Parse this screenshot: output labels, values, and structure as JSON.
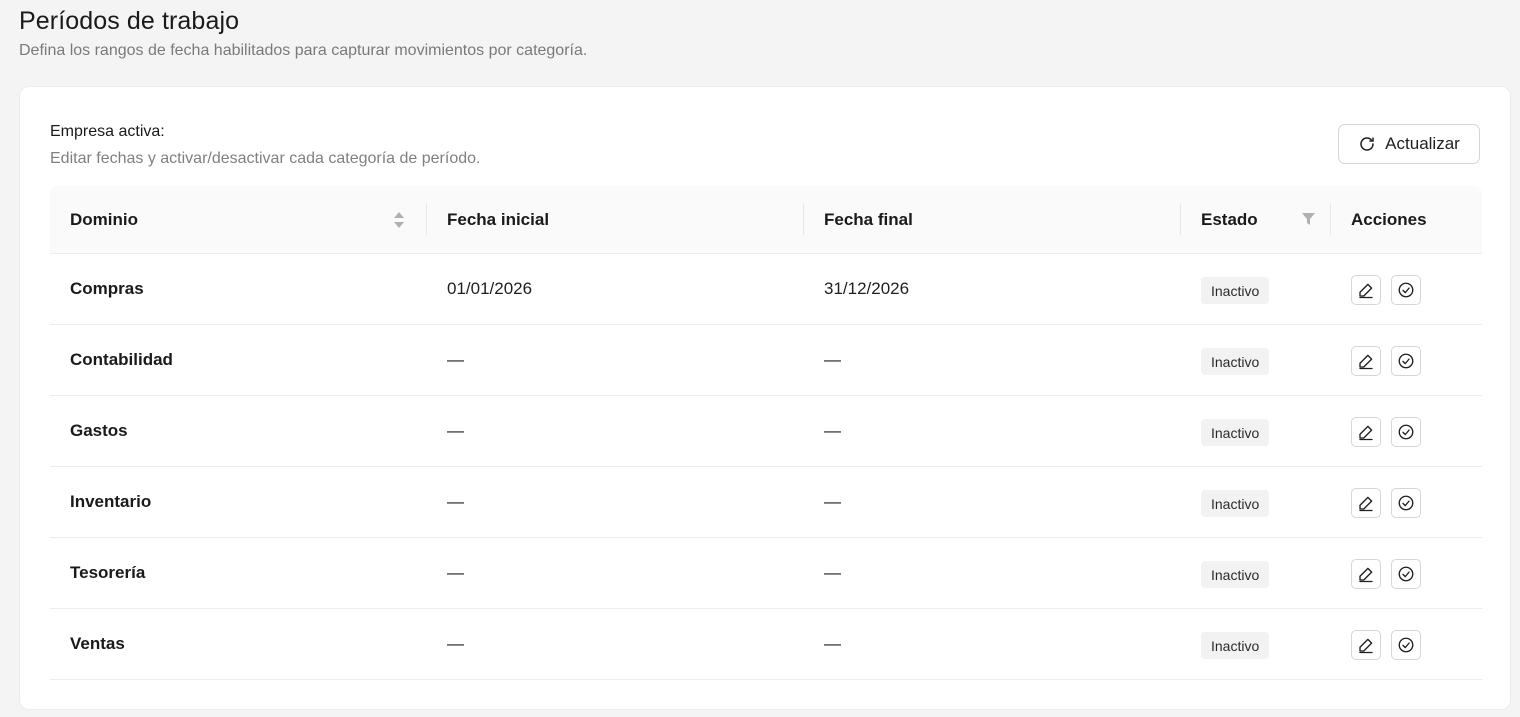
{
  "header": {
    "title": "Períodos de trabajo",
    "subtitle": "Defina los rangos de fecha habilitados para capturar movimientos por categoría."
  },
  "card": {
    "company_label": "Empresa activa:",
    "company_description": "Editar fechas y activar/desactivar cada categoría de período.",
    "refresh_label": "Actualizar"
  },
  "table": {
    "columns": {
      "domain": "Dominio",
      "start_date": "Fecha inicial",
      "end_date": "Fecha final",
      "status": "Estado",
      "actions": "Acciones"
    },
    "rows": [
      {
        "domain": "Compras",
        "start_date": "01/01/2026",
        "end_date": "31/12/2026",
        "status": "Inactivo"
      },
      {
        "domain": "Contabilidad",
        "start_date": "—",
        "end_date": "—",
        "status": "Inactivo"
      },
      {
        "domain": "Gastos",
        "start_date": "—",
        "end_date": "—",
        "status": "Inactivo"
      },
      {
        "domain": "Inventario",
        "start_date": "—",
        "end_date": "—",
        "status": "Inactivo"
      },
      {
        "domain": "Tesorería",
        "start_date": "—",
        "end_date": "—",
        "status": "Inactivo"
      },
      {
        "domain": "Ventas",
        "start_date": "—",
        "end_date": "—",
        "status": "Inactivo"
      }
    ]
  },
  "icons": {
    "refresh": "refresh-icon",
    "sort": "sort-icon",
    "filter": "filter-icon",
    "edit": "edit-icon",
    "activate": "check-circle-icon"
  },
  "colors": {
    "page_background": "#f4f4f4",
    "card_background": "#ffffff",
    "badge_background": "#f2f2f2",
    "header_background": "#fafafa"
  }
}
